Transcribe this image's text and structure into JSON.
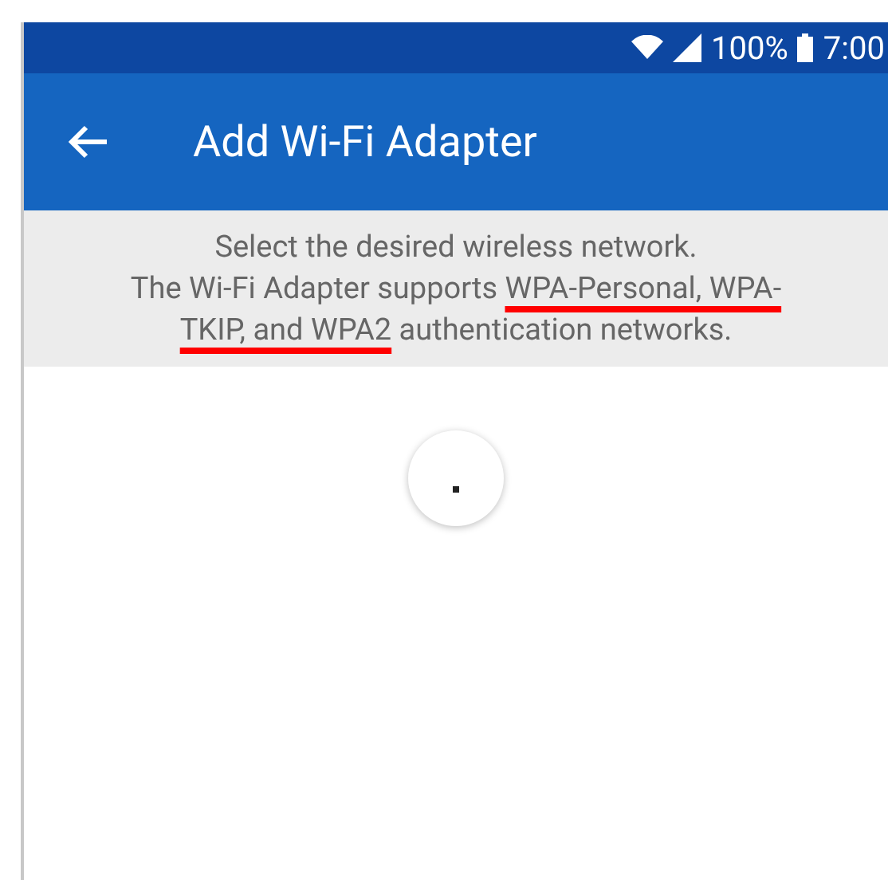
{
  "status_bar": {
    "battery": "100%",
    "time": "7:00"
  },
  "app_bar": {
    "title": "Add Wi-Fi Adapter"
  },
  "info": {
    "heading": "Select the desired wireless network.",
    "sentence_before": "The Wi-Fi Adapter supports ",
    "sentence_highlighted": "WPA-Personal, WPA-TKIP, and WPA2",
    "sentence_after": " authentication networks."
  },
  "loading": true
}
